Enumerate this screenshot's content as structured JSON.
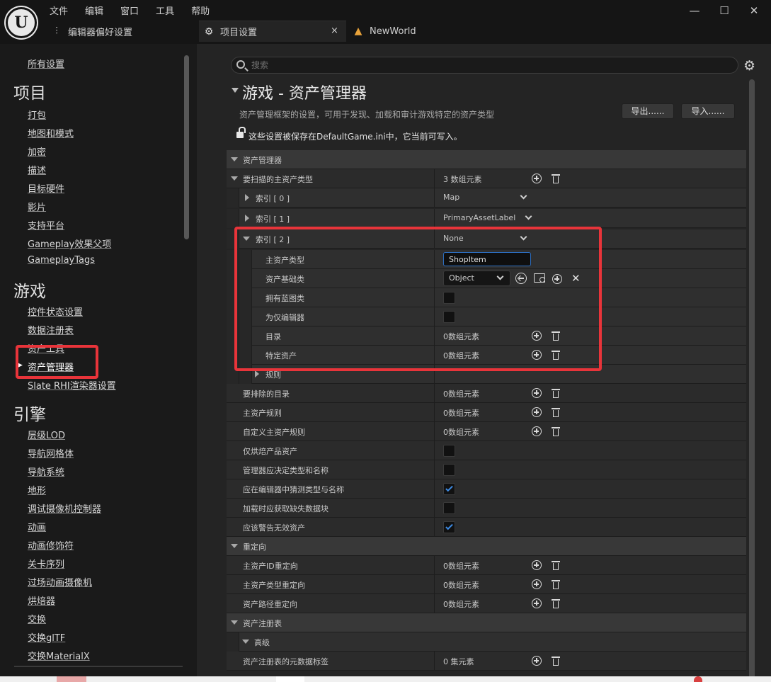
{
  "menu": [
    "文件",
    "编辑",
    "窗口",
    "工具",
    "帮助"
  ],
  "tabs": {
    "editor_prefs": "编辑器偏好设置",
    "project_settings": "项目设置",
    "new_world": "NewWorld"
  },
  "sidebar": {
    "all_settings": "所有设置",
    "project_header": "项目",
    "project_items": [
      "打包",
      "地图和模式",
      "加密",
      "描述",
      "目标硬件",
      "影片",
      "支持平台",
      "Gameplay效果父项",
      "GameplayTags"
    ],
    "game_header": "游戏",
    "game_items": [
      "控件状态设置",
      "数据注册表",
      "资产工具",
      "资产管理器",
      "Slate RHI渲染器设置"
    ],
    "engine_header": "引擎",
    "engine_items": [
      "层级LOD",
      "导航网格体",
      "导航系统",
      "地形",
      "调试摄像机控制器",
      "动画",
      "动画修饰符",
      "关卡序列",
      "过场动画摄像机",
      "烘焙器",
      "交换",
      "交换glTF",
      "交换MaterialX"
    ]
  },
  "search": {
    "placeholder": "搜索"
  },
  "section": {
    "title": "游戏 - 资产管理器",
    "description": "资产管理框架的设置，可用于发现、加载和审计游戏特定的资产类型",
    "export": "导出......",
    "import": "导入......",
    "saved_note": "这些设置被保存在DefaultGame.ini中，它当前可写入。"
  },
  "props": {
    "cat_asset_manager": "资产管理器",
    "primary_types_to_scan": "要扫描的主资产类型",
    "primary_types_count": "3 数组元素",
    "index0": "索引 [ 0 ]",
    "index0_val": "Map",
    "index1": "索引 [ 1 ]",
    "index1_val": "PrimaryAssetLabel",
    "index2": "索引 [ 2 ]",
    "index2_val": "None",
    "primary_asset_type": "主资产类型",
    "primary_asset_type_val": "ShopItem",
    "asset_base_class": "资产基础类",
    "asset_base_class_val": "Object",
    "has_blueprint": "拥有蓝图类",
    "editor_only": "为仅编辑器",
    "directories": "目录",
    "directories_val": "0数组元素",
    "specific_assets": "特定资产",
    "specific_assets_val": "0数组元素",
    "rules": "规则",
    "dirs_to_exclude": "要排除的目录",
    "dirs_to_exclude_val": "0数组元素",
    "primary_asset_rules": "主资产规则",
    "primary_asset_rules_val": "0数组元素",
    "custom_primary_asset_rules": "自定义主资产规则",
    "custom_primary_asset_rules_val": "0数组元素",
    "only_cook_production": "仅烘焙产品资产",
    "manager_determines": "管理器应决定类型和名称",
    "editor_guess": "应在编辑器中猜测类型与名称",
    "load_missing_chunks": "加载时应获取缺失数据块",
    "warn_invalid": "应该警告无效资产",
    "cat_redirects": "重定向",
    "id_redirects": "主资产ID重定向",
    "id_redirects_val": "0数组元素",
    "type_redirects": "主资产类型重定向",
    "type_redirects_val": "0数组元素",
    "path_redirects": "资产路径重定向",
    "path_redirects_val": "0数组元素",
    "cat_registry": "资产注册表",
    "advanced": "高级",
    "registry_tags": "资产注册表的元数据标签",
    "registry_tags_val": "0 集元素"
  },
  "checks": {
    "has_blueprint": false,
    "editor_only": false,
    "only_cook_production": false,
    "manager_determines": false,
    "editor_guess": true,
    "load_missing_chunks": false,
    "warn_invalid": true
  },
  "colors": {
    "highlight": "#e8343a",
    "accent": "#3d8ce6"
  }
}
